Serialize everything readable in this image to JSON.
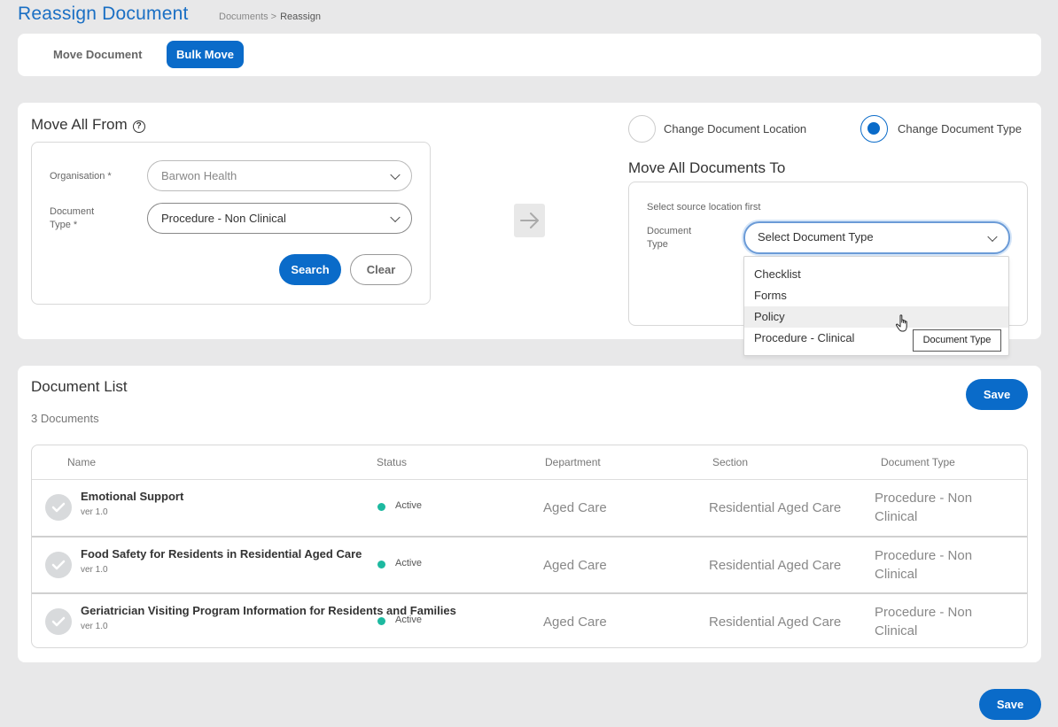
{
  "header": {
    "title": "Reassign Document",
    "breadcrumb": [
      "Documents",
      "Reassign"
    ],
    "breadcrumb_sep": ">"
  },
  "tabs": [
    {
      "label": "Move Document",
      "active": false
    },
    {
      "label": "Bulk Move",
      "active": true
    }
  ],
  "move_from": {
    "title": "Move All From",
    "help_icon": "?",
    "organisation_label": "Organisation *",
    "organisation_value": "Barwon Health",
    "doc_type_label_1": "Document",
    "doc_type_label_2": "Type *",
    "doc_type_value": "Procedure - Non Clinical",
    "search_label": "Search",
    "clear_label": "Clear"
  },
  "mode": {
    "options": [
      {
        "label": "Change Document Location",
        "checked": false
      },
      {
        "label": "Change Document Type",
        "checked": true
      }
    ]
  },
  "move_to": {
    "title": "Move All Documents To",
    "hint": "Select source location first",
    "doc_type_label_1": "Document",
    "doc_type_label_2": "Type",
    "doc_type_placeholder": "Select Document Type",
    "dropdown_options": [
      "Checklist",
      "Forms",
      "Policy",
      "Procedure - Clinical"
    ],
    "hovered_option": "Policy",
    "tooltip": "Document Type"
  },
  "document_list": {
    "title": "Document List",
    "count": "3 Documents",
    "save_label": "Save",
    "columns": [
      "Name",
      "Status",
      "Department",
      "Section",
      "Document Type"
    ],
    "rows": [
      {
        "name": "Emotional Support",
        "version": "ver 1.0",
        "status": "Active",
        "department": "Aged Care",
        "section": "Residential Aged Care",
        "type_1": "Procedure - Non",
        "type_2": "Clinical"
      },
      {
        "name": "Food Safety for Residents in Residential Aged Care",
        "version": "ver 1.0",
        "status": "Active",
        "department": "Aged Care",
        "section": "Residential Aged Care",
        "type_1": "Procedure - Non",
        "type_2": "Clinical"
      },
      {
        "name": "Geriatrician Visiting Program Information for Residents and Families",
        "version": "ver 1.0",
        "status": "Active",
        "department": "Aged Care",
        "section": "Residential Aged Care",
        "type_1": "Procedure - Non",
        "type_2": "Clinical"
      }
    ]
  },
  "footer": {
    "save_label": "Save"
  },
  "colors": {
    "accent": "#0a6bc9",
    "status_active": "#1db9a0",
    "background": "#e8e8e9"
  }
}
